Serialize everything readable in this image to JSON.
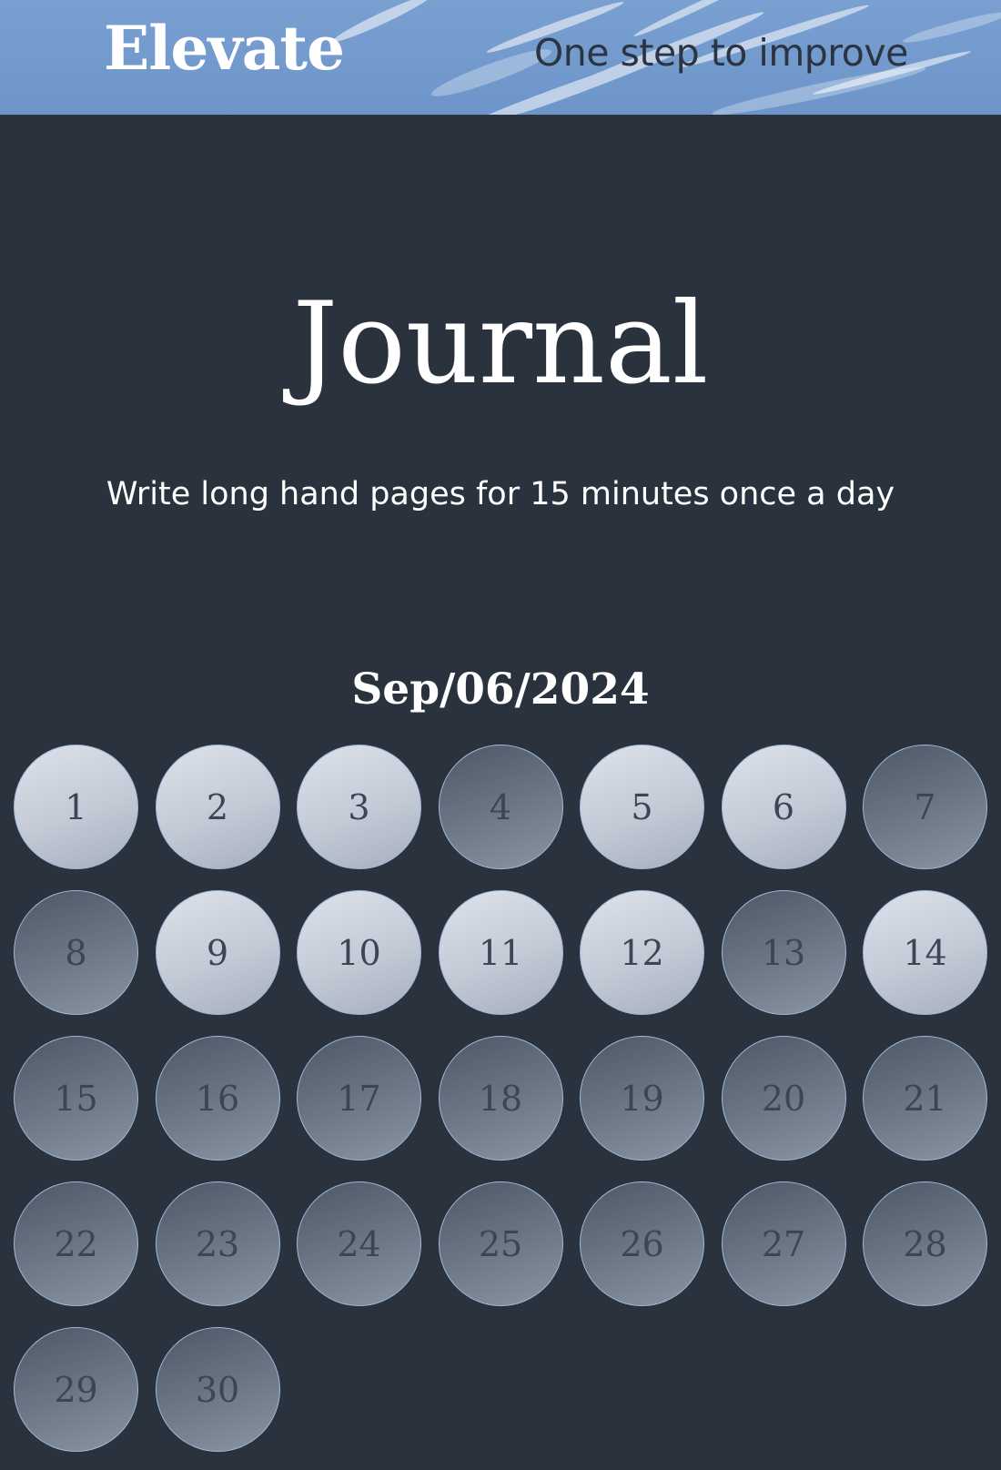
{
  "header": {
    "brand": "Elevate",
    "tagline": "One step to improve"
  },
  "main": {
    "title": "Journal",
    "subtitle": "Write long hand pages for 15 minutes once a day",
    "date": "Sep/06/2024"
  },
  "calendar": {
    "days": [
      {
        "label": "1",
        "done": true
      },
      {
        "label": "2",
        "done": true
      },
      {
        "label": "3",
        "done": true
      },
      {
        "label": "4",
        "done": false
      },
      {
        "label": "5",
        "done": true
      },
      {
        "label": "6",
        "done": true
      },
      {
        "label": "7",
        "done": false
      },
      {
        "label": "8",
        "done": false
      },
      {
        "label": "9",
        "done": true
      },
      {
        "label": "10",
        "done": true
      },
      {
        "label": "11",
        "done": true
      },
      {
        "label": "12",
        "done": true
      },
      {
        "label": "13",
        "done": false
      },
      {
        "label": "14",
        "done": true
      },
      {
        "label": "15",
        "done": false
      },
      {
        "label": "16",
        "done": false
      },
      {
        "label": "17",
        "done": false
      },
      {
        "label": "18",
        "done": false
      },
      {
        "label": "19",
        "done": false
      },
      {
        "label": "20",
        "done": false
      },
      {
        "label": "21",
        "done": false
      },
      {
        "label": "22",
        "done": false
      },
      {
        "label": "23",
        "done": false
      },
      {
        "label": "24",
        "done": false
      },
      {
        "label": "25",
        "done": false
      },
      {
        "label": "26",
        "done": false
      },
      {
        "label": "27",
        "done": false
      },
      {
        "label": "28",
        "done": false
      },
      {
        "label": "29",
        "done": false
      },
      {
        "label": "30",
        "done": false
      }
    ]
  },
  "colors": {
    "background": "#29323d",
    "header_sky": "#7aa0d2",
    "circle_border": "#9db8dc",
    "completed_fill": "#d2d7e0",
    "pending_fill": "#6b7685",
    "day_text": "#3a4556"
  }
}
